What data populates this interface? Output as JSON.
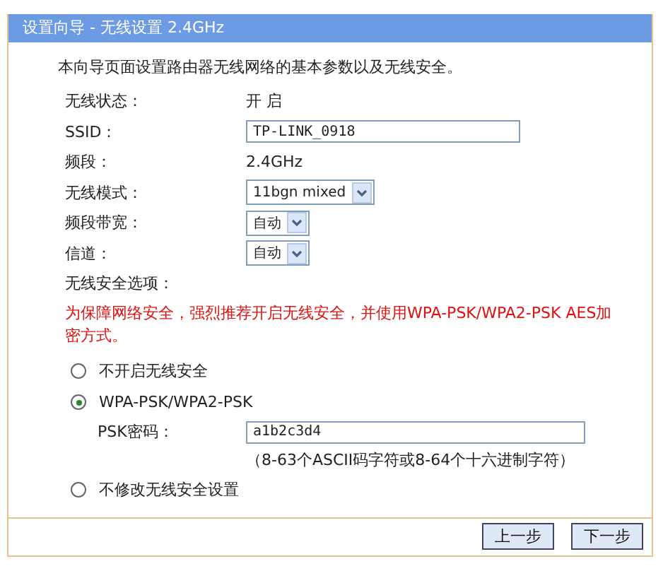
{
  "window": {
    "title": "设置向导 - 无线设置 2.4GHz"
  },
  "intro": "本向导页面设置路由器无线网络的基本参数以及无线安全。",
  "fields": [
    {
      "kind": "text",
      "label": "无线状态：",
      "value": "开 启"
    },
    {
      "kind": "input",
      "label": "SSID：",
      "value": "TP-LINK_0918"
    },
    {
      "kind": "text",
      "label": "频段：",
      "value": "2.4GHz"
    },
    {
      "kind": "select",
      "label": "无线模式：",
      "value": "11bgn mixed"
    },
    {
      "kind": "select",
      "label": "频段带宽：",
      "value": "自动"
    },
    {
      "kind": "select",
      "label": "信道：",
      "value": "自动"
    }
  ],
  "security": {
    "label": "无线安全选项：",
    "warning": "为保障网络安全，强烈推荐开启无线安全，并使用WPA-PSK/WPA2-PSK AES加密方式。",
    "options": [
      {
        "label": "不开启无线安全",
        "selected": false
      },
      {
        "label": "WPA-PSK/WPA2-PSK",
        "selected": true,
        "psk": {
          "label": "PSK密码：",
          "value": "a1b2c3d4",
          "hint": "（8-63个ASCII码字符或8-64个十六进制字符）"
        }
      },
      {
        "label": "不修改无线安全设置",
        "selected": false
      }
    ]
  },
  "buttons": [
    "上一步",
    "下一步"
  ]
}
